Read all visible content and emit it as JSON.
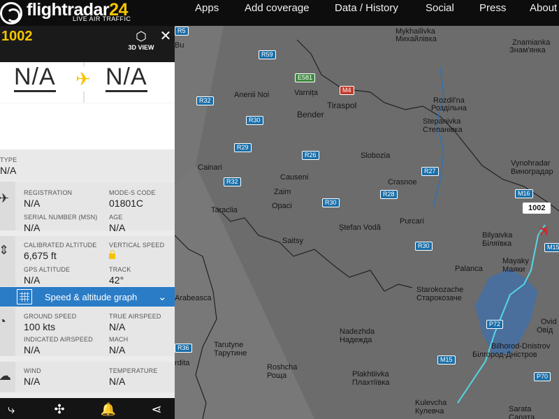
{
  "header": {
    "logo_main": "flightradar",
    "logo_num": "24",
    "logo_tag": "LIVE AIR TRAFFIC",
    "nav": [
      "Apps",
      "Add coverage",
      "Data / History",
      "Social",
      "Press",
      "About"
    ]
  },
  "panel": {
    "callsign": "1002",
    "view3d_label": "3D VIEW",
    "origin": "N/A",
    "destination": "N/A",
    "aircraft": {
      "type_label": "TYPE",
      "type_value": "N/A",
      "registration_label": "REGISTRATION",
      "registration_value": "N/A",
      "modes_label": "MODE-S CODE",
      "modes_value": "01801C",
      "serial_label": "SERIAL NUMBER (MSN)",
      "serial_value": "N/A",
      "age_label": "AGE",
      "age_value": "N/A"
    },
    "altitude": {
      "cal_alt_label": "CALIBRATED ALTITUDE",
      "cal_alt_value": "6,675 ft",
      "vspeed_label": "VERTICAL SPEED",
      "gps_alt_label": "GPS ALTITUDE",
      "gps_alt_value": "N/A",
      "track_label": "TRACK",
      "track_value": "42°"
    },
    "graph_label": "Speed & altitude graph",
    "speed": {
      "ground_label": "GROUND SPEED",
      "ground_value": "100 kts",
      "true_label": "TRUE AIRSPEED",
      "true_value": "N/A",
      "indicated_label": "INDICATED AIRSPEED",
      "indicated_value": "N/A",
      "mach_label": "MACH",
      "mach_value": "N/A"
    },
    "weather": {
      "wind_label": "WIND",
      "wind_value": "N/A",
      "temp_label": "TEMPERATURE",
      "temp_value": "N/A"
    }
  },
  "map": {
    "flight_label": "1002",
    "places": [
      "Mykhailivka",
      "Михайлівка",
      "Znamianka",
      "Знам'янка",
      "Anenii Noi",
      "Varnița",
      "Rozdil'na",
      "Роздільна",
      "Bender",
      "Tiraspol",
      "Stepanivka",
      "Степанівка",
      "Slobozia",
      "Cainari",
      "Causeni",
      "Vynohradar",
      "Виноградар",
      "Zaim",
      "Crasnoe",
      "Opaci",
      "Taraclia",
      "Ștefan Vodă",
      "Purcari",
      "Bilyaivka",
      "Біляївка",
      "Saitsy",
      "Palanca",
      "Mayaky",
      "Маяки",
      "Starokozache",
      "Старокозаче",
      "Arabeasca",
      "Ovid",
      "Овід",
      "Nadezhda",
      "Надежда",
      "Bilhorod-Dnistrov",
      "Білгород-Дністров",
      "Tarutyne",
      "Тарутине",
      "rdita",
      "Roshcha",
      "Роща",
      "Plakhtiivka",
      "Плахтіївка",
      "Kulevcha",
      "Кулевча",
      "Sarata",
      "Сарата",
      "Bu"
    ],
    "roads": [
      "R5",
      "R59",
      "E581",
      "M4",
      "R32",
      "R30",
      "R29",
      "R26",
      "R32",
      "R27",
      "R28",
      "M16",
      "R30",
      "R30",
      "M15",
      "P72",
      "M15",
      "R36",
      "P70"
    ]
  },
  "colors": {
    "accent": "#f5c400",
    "bar": "#2a7cc7",
    "track": "#56d6e6"
  }
}
